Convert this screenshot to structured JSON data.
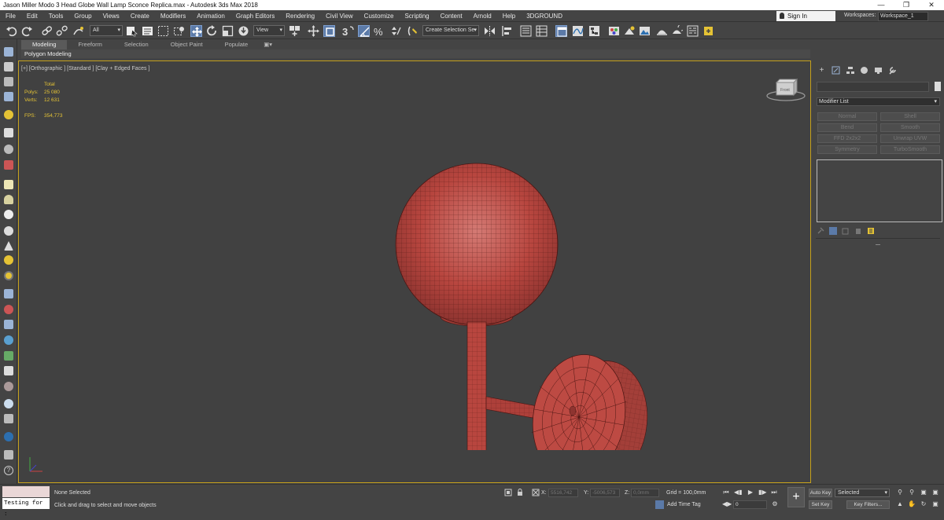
{
  "window": {
    "title": "Jason Miller Modo 3 Head Globe Wall Lamp Sconce Replica.max - Autodesk 3ds Max 2018",
    "controls": {
      "minimize": "—",
      "maximize": "❐",
      "close": "✕"
    }
  },
  "menu": [
    "File",
    "Edit",
    "Tools",
    "Group",
    "Views",
    "Create",
    "Modifiers",
    "Animation",
    "Graph Editors",
    "Rendering",
    "Civil View",
    "Customize",
    "Scripting",
    "Content",
    "Arnold",
    "Help",
    "3DGROUND"
  ],
  "account": {
    "sign_in": "Sign In",
    "workspaces_label": "Workspaces:",
    "workspace": "Workspace_1"
  },
  "toolbar": {
    "selection_filter": "All",
    "ref_coord": "View",
    "named_selection": "Create Selection Se",
    "icons": [
      "undo-icon",
      "redo-icon",
      "link-icon",
      "unlink-icon",
      "bind-spacewarp-icon",
      "select-object-icon",
      "select-by-name-icon",
      "rect-selection-icon",
      "window-crossing-icon",
      "select-move-icon",
      "select-rotate-icon",
      "select-scale-icon",
      "select-place-icon",
      "pivot-center-icon",
      "select-manipulate-icon",
      "keyboard-shortcut-icon",
      "snaps-toggle-icon",
      "angle-snap-icon",
      "percent-snap-icon",
      "spinner-snap-icon",
      "edit-named-sets-icon",
      "mirror-icon",
      "align-icon",
      "scene-explorer-icon",
      "layer-explorer-icon",
      "toggle-ribbon-icon",
      "curve-editor-icon",
      "schematic-view-icon",
      "material-editor-icon",
      "render-setup-icon",
      "rendered-frame-icon",
      "render-production-icon",
      "render-iterative-icon",
      "render-cloud-icon",
      "a360-gallery-icon"
    ]
  },
  "ribbon": {
    "tabs": [
      "Modeling",
      "Freeform",
      "Selection",
      "Object Paint",
      "Populate"
    ],
    "active_tab": "Modeling",
    "panel": "Polygon Modeling"
  },
  "viewport": {
    "label": "[+] [Orthographic ] [Standard ] [Clay + Edged Faces ]",
    "stats": {
      "header": "Total",
      "polys_label": "Polys:",
      "polys": "25 080",
      "verts_label": "Verts:",
      "verts": "12 631",
      "fps_label": "FPS:",
      "fps": "354,773"
    },
    "viewcube_face": "Front",
    "model_color": "#b8463f"
  },
  "command_panel": {
    "tabs": [
      "create-tab-icon",
      "modify-tab-icon",
      "hierarchy-tab-icon",
      "motion-tab-icon",
      "display-tab-icon",
      "utilities-tab-icon"
    ],
    "modifier_list": "Modifier List",
    "modifier_buttons": [
      "Normal",
      "Shell",
      "Bend",
      "Smooth",
      "FFD 2x2x2",
      "Unwrap UVW",
      "Symmetry",
      "TurboSmooth"
    ]
  },
  "status": {
    "maxscript_input": "Testing for :",
    "selection": "None Selected",
    "prompt": "Click and drag to select and move objects",
    "x_label": "X:",
    "x": "5516,742",
    "y_label": "Y:",
    "y": "-5006,573",
    "z_label": "Z:",
    "z": "0,0mm",
    "grid": "Grid = 100,0mm",
    "add_time_tag": "Add Time Tag",
    "frame": "0",
    "auto_key": "Auto Key",
    "set_key": "Set Key",
    "selected": "Selected",
    "key_filters": "Key Filters..."
  },
  "colors": {
    "ui_bg": "#444444",
    "viewport_bg": "#414141",
    "viewport_border": "#c6a11c",
    "stats_text": "#e5c335",
    "model": "#b8463f",
    "selected_btn": "#5b7aa8"
  }
}
